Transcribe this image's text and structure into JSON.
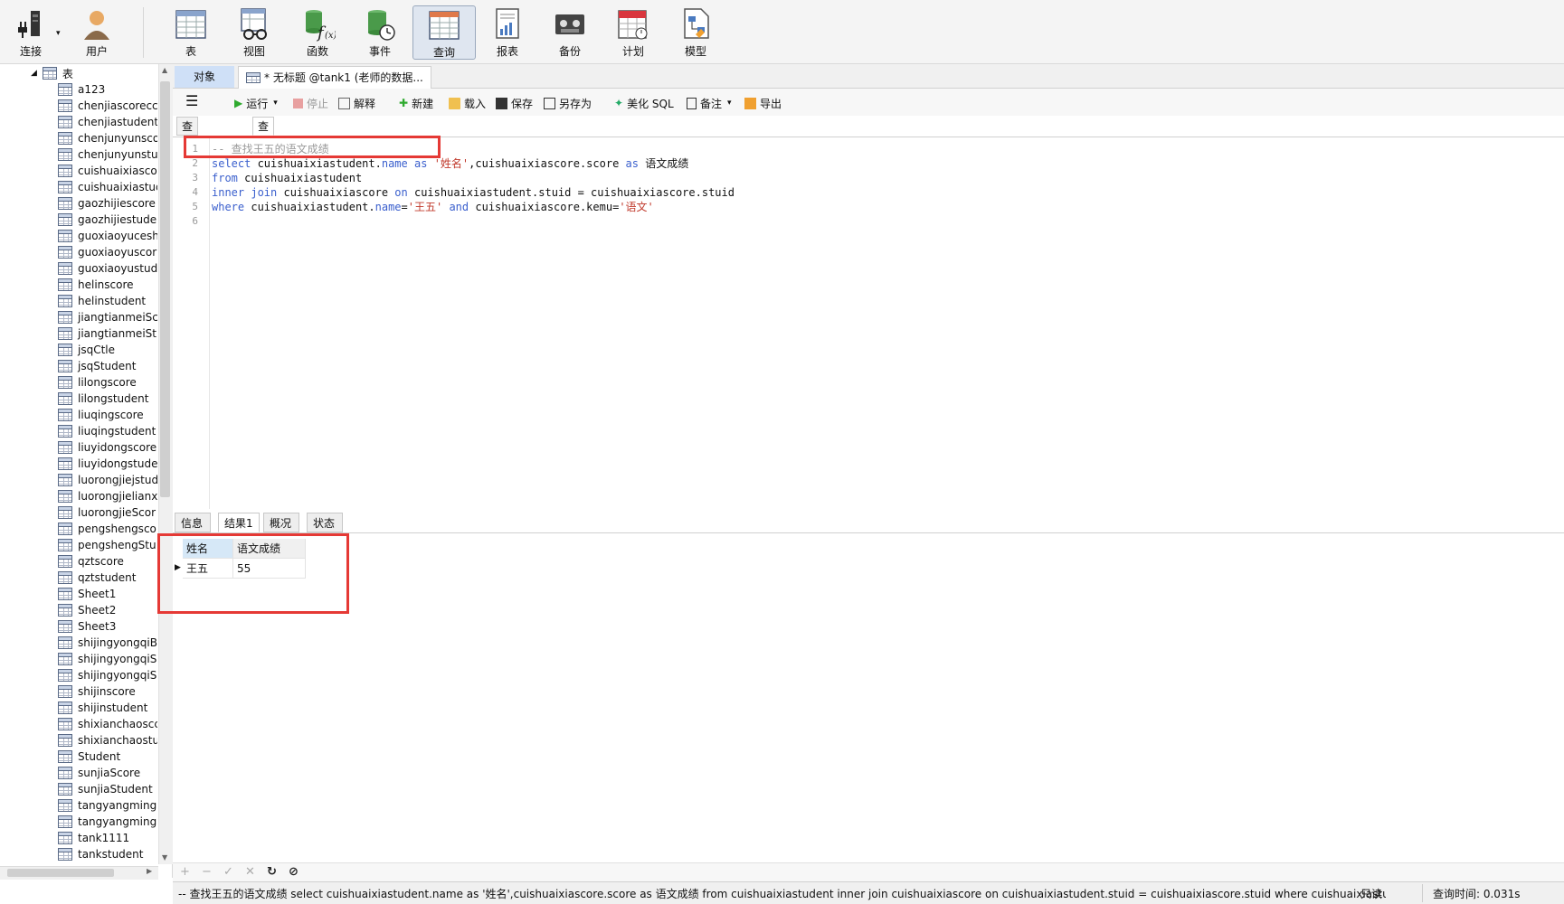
{
  "toolbar": {
    "items": [
      {
        "label": "连接",
        "icon": "plug-icon"
      },
      {
        "label": "用户",
        "icon": "user-icon"
      },
      {
        "label": "表",
        "icon": "table-icon"
      },
      {
        "label": "视图",
        "icon": "view-glasses-icon"
      },
      {
        "label": "函数",
        "icon": "function-icon"
      },
      {
        "label": "事件",
        "icon": "event-clock-icon"
      },
      {
        "label": "查询",
        "icon": "query-icon"
      },
      {
        "label": "报表",
        "icon": "report-icon"
      },
      {
        "label": "备份",
        "icon": "backup-icon"
      },
      {
        "label": "计划",
        "icon": "calendar-icon"
      },
      {
        "label": "模型",
        "icon": "model-icon"
      }
    ],
    "active": "查询"
  },
  "sidebar": {
    "root_label": "表",
    "items": [
      "a123",
      "chenjiascorecc",
      "chenjiastudent",
      "chenjunyunsco",
      "chenjunyunstuc",
      "cuishuaixiascor",
      "cuishuaixiastud",
      "gaozhijiescore",
      "gaozhijiestude",
      "guoxiaoyucesh",
      "guoxiaoyuscor",
      "guoxiaoyustud",
      "helinscore",
      "helinstudent",
      "jiangtianmeiSc",
      "jiangtianmeiStu",
      "jsqCtle",
      "jsqStudent",
      "lilongscore",
      "lilongstudent",
      "liuqingscore",
      "liuqingstudent",
      "liuyidongscore",
      "liuyidongstude",
      "luorongjiejstud",
      "luorongjielianx",
      "luorongjieScor",
      "pengshengsco",
      "pengshengStu",
      "qztscore",
      "qztstudent",
      "Sheet1",
      "Sheet2",
      "Sheet3",
      "shijingyongqiB",
      "shijingyongqiS",
      "shijingyongqiS",
      "shijinscore",
      "shijinstudent",
      "shixianchaoscc",
      "shixianchaostu",
      "Student",
      "sunjiaScore",
      "sunjiaStudent",
      "tangyangming",
      "tangyangming",
      "tank1111",
      "tankstudent"
    ]
  },
  "tabs": {
    "objects": "对象",
    "query": "* 无标题 @tank1 (老师的数据..."
  },
  "query_toolbar": {
    "run": "运行",
    "stop": "停止",
    "explain": "解释",
    "new": "新建",
    "load": "载入",
    "save": "保存",
    "save_as": "另存为",
    "beautify": "美化 SQL",
    "comment": "备注",
    "export": "导出"
  },
  "editor_tabs": {
    "builder": "查询创建工具",
    "editor": "查询编辑器"
  },
  "code": {
    "line_numbers": [
      "1",
      "2",
      "3",
      "4",
      "5",
      "6"
    ],
    "l1": "-- 查找王五的语文成绩",
    "l2": {
      "k1": "select",
      "t1": " cuishuaixiastudent.",
      "k2": "name",
      "t2": " ",
      "k3": "as",
      "t3": " ",
      "s1": "'姓名'",
      "t4": ",cuishuaixiascore.score ",
      "k4": "as",
      "t5": " 语文成绩"
    },
    "l3": {
      "k1": "from",
      "t1": " cuishuaixiastudent"
    },
    "l4": {
      "k1": "inner join",
      "t1": " cuishuaixiascore ",
      "k2": "on",
      "t2": " cuishuaixiastudent.stuid = cuishuaixiascore.stuid"
    },
    "l5": {
      "k1": "where",
      "t1": " cuishuaixiastudent.",
      "k2": "name",
      "t2": "=",
      "s1": "'王五'",
      "t3": " ",
      "k3": "and",
      "t4": " cuishuaixiascore.kemu=",
      "s2": "'语文'"
    }
  },
  "result_tabs": [
    "信息",
    "结果1",
    "概况",
    "状态"
  ],
  "result_active": "结果1",
  "grid": {
    "columns": [
      "姓名",
      "语文成绩"
    ],
    "rows": [
      [
        "王五",
        "55"
      ]
    ]
  },
  "bottom_icons": [
    "plus-icon",
    "minus-icon",
    "check-icon",
    "cross-icon",
    "refresh-icon",
    "stop-icon"
  ],
  "bottom_glyphs": {
    "plus": "+",
    "minus": "−",
    "check": "✓",
    "cross": "✕",
    "refresh": "↻",
    "stop": "⊘"
  },
  "status": {
    "sql": "-- 查找王五的语文成绩 select cuishuaixiastudent.name as '姓名',cuishuaixiascore.score as 语文成绩 from cuishuaixiastudent  inner join cuishuaixiascore on cuishuaixiastudent.stuid = cuishuaixiascore.stuid where cuishuaixiastuder",
    "readonly": "只读",
    "query_time": "查询时间: 0.031s"
  },
  "colors": {
    "accent_red": "#e53935",
    "keyword": "#3a5fcd",
    "string": "#c0392b",
    "run_green": "#2eaa2e"
  }
}
